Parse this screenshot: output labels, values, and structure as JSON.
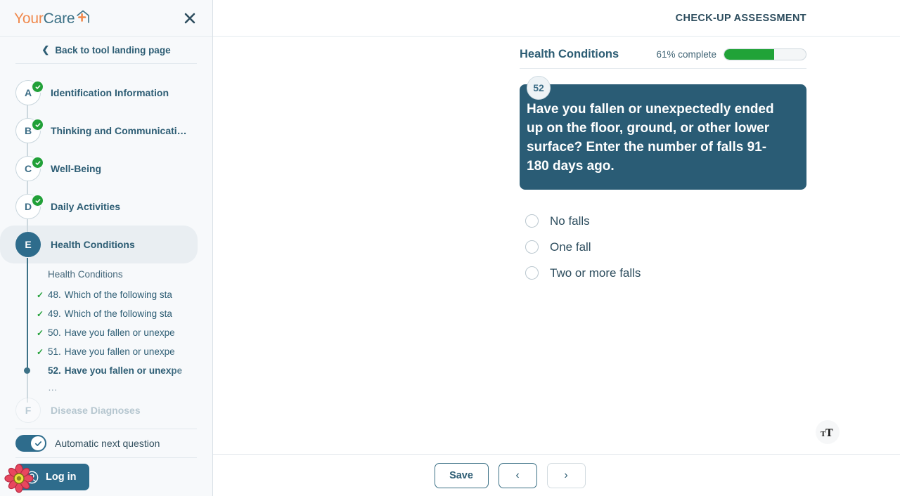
{
  "sidebar": {
    "logo": {
      "part1": "Your",
      "part2": "Care",
      "mark": "house-plus-icon"
    },
    "close_label": "close-icon",
    "back_label": "Back to tool landing page",
    "steps": [
      {
        "key": "A",
        "label": "Identification Information",
        "complete": true,
        "active": false
      },
      {
        "key": "B",
        "label": "Thinking and Communicati…",
        "complete": true,
        "active": false
      },
      {
        "key": "C",
        "label": "Well-Being",
        "complete": true,
        "active": false
      },
      {
        "key": "D",
        "label": "Daily Activities",
        "complete": true,
        "active": false
      },
      {
        "key": "E",
        "label": "Health Conditions",
        "complete": false,
        "active": true
      },
      {
        "key": "F",
        "label": "Disease Diagnoses",
        "complete": false,
        "active": false
      }
    ],
    "subnav": {
      "title": "Health Conditions",
      "items": [
        {
          "num": "48.",
          "text": "Which of the following sta",
          "done": true,
          "current": false
        },
        {
          "num": "49.",
          "text": "Which of the following sta",
          "done": true,
          "current": false
        },
        {
          "num": "50.",
          "text": "Have you fallen or unexpe",
          "done": true,
          "current": false
        },
        {
          "num": "51.",
          "text": "Have you fallen or unexpe",
          "done": true,
          "current": false
        },
        {
          "num": "52.",
          "text": "Have you fallen or unexpe",
          "done": false,
          "current": true
        }
      ],
      "more": "…"
    },
    "auto_next_label": "Automatic next question",
    "auto_next_on": true,
    "login_label": "Log in"
  },
  "header": {
    "title": "CHECK-UP ASSESSMENT"
  },
  "section": {
    "title": "Health Conditions",
    "progress_text": "61% complete",
    "progress_percent": 61
  },
  "question": {
    "number": "52",
    "text": "Have you fallen or unexpectedly ended up on the floor, ground, or other lower surface? Enter the number of falls 91-180 days ago.",
    "options": [
      {
        "label": "No falls",
        "selected": false
      },
      {
        "label": "One fall",
        "selected": false
      },
      {
        "label": "Two or more falls",
        "selected": false
      }
    ]
  },
  "footer": {
    "save_label": "Save",
    "prev_label": "‹",
    "next_label": "›",
    "text_size_label": "text-size-icon"
  },
  "colors": {
    "accent_teal": "#2e6c8c",
    "card_teal": "#2a5c75",
    "progress_green": "#21a338",
    "logo_orange": "#f08a4e",
    "sidebar_bg": "#f7f9fb"
  }
}
